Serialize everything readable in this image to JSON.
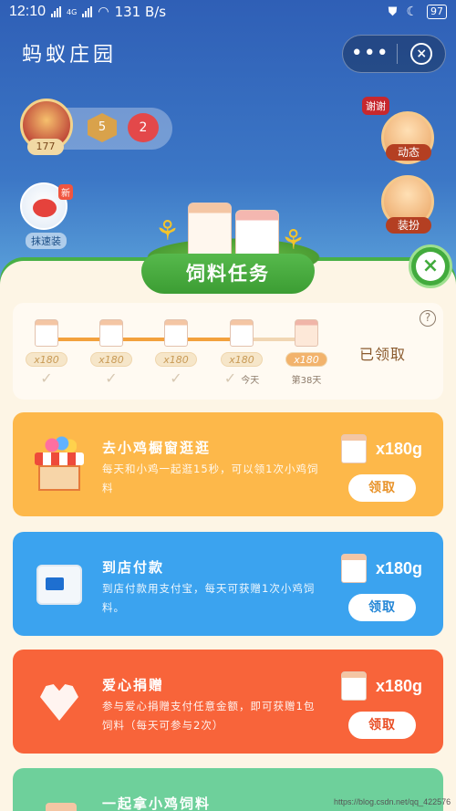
{
  "status_bar": {
    "time": "12:10",
    "network_speed": "131 B/s",
    "battery": "97",
    "network_type": "4G"
  },
  "header": {
    "title": "蚂蚁庄园",
    "more_label": "•••",
    "close_label": "×"
  },
  "game": {
    "level": "177",
    "hex_value": "5",
    "heart_value": "2",
    "new_tag": "新",
    "speed_label": "抹速装",
    "xie_tag": "谢谢",
    "dongtai_label": "动态",
    "zhuangban_label": "装扮"
  },
  "panel": {
    "title": "饲料任务",
    "close_label": "×",
    "help_label": "?",
    "claimed_label": "已领取",
    "steps": [
      {
        "amount": "x180",
        "mark": "✓",
        "note": ""
      },
      {
        "amount": "x180",
        "mark": "✓",
        "note": ""
      },
      {
        "amount": "x180",
        "mark": "✓",
        "note": ""
      },
      {
        "amount": "x180",
        "mark": "✓",
        "note": "今天"
      },
      {
        "amount": "x180",
        "mark": "",
        "note": "第38天"
      }
    ],
    "progress_fraction": 0.76
  },
  "tasks": [
    {
      "title": "去小鸡橱窗逛逛",
      "desc": "每天和小鸡一起逛15秒，可以领1次小鸡饲料",
      "reward": "x180g",
      "button": "领取",
      "icon": "shop-icon"
    },
    {
      "title": "到店付款",
      "desc": "到店付款用支付宝，每天可获赠1次小鸡饲料。",
      "reward": "x180g",
      "button": "领取",
      "icon": "pos-terminal-icon"
    },
    {
      "title": "爱心捐赠",
      "desc": "参与爱心捐赠支付任意金额，即可获赠1包饲料（每天可参与2次）",
      "reward": "x180g",
      "button": "领取",
      "icon": "heart-icon"
    },
    {
      "title": "一起拿小鸡饲料",
      "icon": "feed-bag-icon"
    }
  ],
  "watermark": "https://blog.csdn.net/qq_422576",
  "colors": {
    "task1": "#fdb84a",
    "task2": "#3ba3ef",
    "task3": "#f8643a",
    "task4": "#6ed09b",
    "panel_green": "#42ab3d"
  }
}
